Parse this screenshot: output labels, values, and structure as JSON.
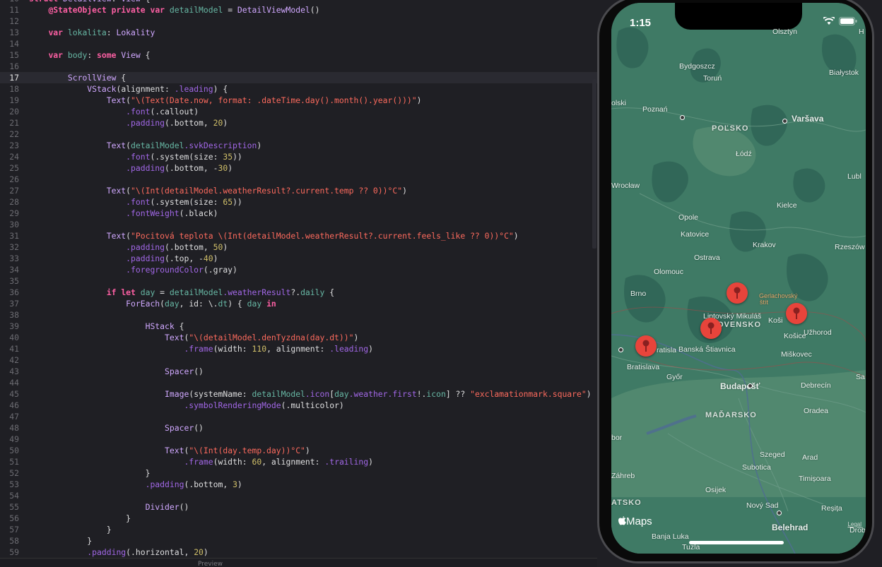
{
  "editor": {
    "lines": [
      {
        "n": "10",
        "text": "struct DetailView: View {"
      },
      {
        "n": "11",
        "text": "    @StateObject private var detailModel = DetailViewModel()"
      },
      {
        "n": "12",
        "text": ""
      },
      {
        "n": "13",
        "text": "    var lokalita: Lokality"
      },
      {
        "n": "14",
        "text": ""
      },
      {
        "n": "15",
        "text": "    var body: some View {"
      },
      {
        "n": "16",
        "text": ""
      },
      {
        "n": "17",
        "text": "        ScrollView {"
      },
      {
        "n": "18",
        "text": "            VStack(alignment: .leading) {"
      },
      {
        "n": "19",
        "text": "                Text(\"\\(Text(Date.now, format: .dateTime.day().month().year()))\")"
      },
      {
        "n": "20",
        "text": "                    .font(.callout)"
      },
      {
        "n": "21",
        "text": "                    .padding(.bottom, 20)"
      },
      {
        "n": "22",
        "text": ""
      },
      {
        "n": "23",
        "text": "                Text(detailModel.svkDescription)"
      },
      {
        "n": "24",
        "text": "                    .font(.system(size: 35))"
      },
      {
        "n": "25",
        "text": "                    .padding(.bottom, -30)"
      },
      {
        "n": "26",
        "text": ""
      },
      {
        "n": "27",
        "text": "                Text(\"\\(Int(detailModel.weatherResult?.current.temp ?? 0))°C\")"
      },
      {
        "n": "28",
        "text": "                    .font(.system(size: 65))"
      },
      {
        "n": "29",
        "text": "                    .fontWeight(.black)"
      },
      {
        "n": "30",
        "text": ""
      },
      {
        "n": "31",
        "text": "                Text(\"Pocitová teplota \\(Int(detailModel.weatherResult?.current.feels_like ?? 0))°C\")"
      },
      {
        "n": "32",
        "text": "                    .padding(.bottom, 50)"
      },
      {
        "n": "33",
        "text": "                    .padding(.top, -40)"
      },
      {
        "n": "34",
        "text": "                    .foregroundColor(.gray)"
      },
      {
        "n": "35",
        "text": ""
      },
      {
        "n": "36",
        "text": "                if let day = detailModel.weatherResult?.daily {"
      },
      {
        "n": "37",
        "text": "                    ForEach(day, id: \\.dt) { day in"
      },
      {
        "n": "38",
        "text": ""
      },
      {
        "n": "39",
        "text": "                        HStack {"
      },
      {
        "n": "40",
        "text": "                            Text(\"\\(detailModel.denTyzdna(day.dt))\")"
      },
      {
        "n": "41",
        "text": "                                .frame(width: 110, alignment: .leading)"
      },
      {
        "n": "42",
        "text": ""
      },
      {
        "n": "43",
        "text": "                            Spacer()"
      },
      {
        "n": "44",
        "text": ""
      },
      {
        "n": "45",
        "text": "                            Image(systemName: detailModel.icon[day.weather.first!.icon] ?? \"exclamationmark.square\")"
      },
      {
        "n": "46",
        "text": "                                .symbolRenderingMode(.multicolor)"
      },
      {
        "n": "47",
        "text": ""
      },
      {
        "n": "48",
        "text": "                            Spacer()"
      },
      {
        "n": "49",
        "text": ""
      },
      {
        "n": "50",
        "text": "                            Text(\"\\(Int(day.temp.day))°C\")"
      },
      {
        "n": "51",
        "text": "                                .frame(width: 60, alignment: .trailing)"
      },
      {
        "n": "52",
        "text": "                        }"
      },
      {
        "n": "53",
        "text": "                        .padding(.bottom, 3)"
      },
      {
        "n": "54",
        "text": ""
      },
      {
        "n": "55",
        "text": "                        Divider()"
      },
      {
        "n": "56",
        "text": "                    }"
      },
      {
        "n": "57",
        "text": "                }"
      },
      {
        "n": "58",
        "text": "            }"
      },
      {
        "n": "59",
        "text": "            .padding(.horizontal, 20)"
      }
    ]
  },
  "statusbar": {
    "label": "Preview"
  },
  "phone": {
    "time": "1:15",
    "maps_logo": "Maps",
    "legal": "Legal",
    "labels": {
      "olsztyn": "Olsztyn",
      "h": "H",
      "bydgoszcz": "Bydgoszcz",
      "torun": "Toruń",
      "bialystok": "Białystok",
      "olski": "olski",
      "poznan": "Poznań",
      "varsava": "Varšava",
      "polsko": "POĽSKO",
      "lodz": "Łódź",
      "lubl": "Lubl",
      "wroclaw": "Wrocław",
      "kielce": "Kielce",
      "opole": "Opole",
      "katovice": "Katovice",
      "krakov": "Krakov",
      "rzeszow": "Rzeszów",
      "ostrava": "Ostrava",
      "olomouc": "Olomouc",
      "brno": "Brno",
      "gerlach": "Gerlachovský",
      "stit": "štít",
      "liptovsky": "Liptovský Mikuláš",
      "slovensko": "OVENSKO",
      "kosice1": "Koši",
      "uzhorod": "Užhorod",
      "kosice2": "Košice",
      "ratisla": "ratisla",
      "banska": "Banská Štiavnica",
      "miskovec": "Miškovec",
      "bratislava": "Bratislava",
      "gyor": "Győr",
      "budapest": "Budapešť",
      "debrecin": "Debrecín",
      "sa": "Sa",
      "oradea": "Oradea",
      "madarsko": "MAĎARSKO",
      "bor": "bor",
      "szeged": "Szeged",
      "arad": "Arad",
      "subotica": "Subotica",
      "zahreb": "Záhreb",
      "timisoara": "Timișoara",
      "osijek": "Osijek",
      "atsko": "ATSKO",
      "novysad": "Nový Sad",
      "resita": "Reșița",
      "belehrad": "Belehrad",
      "drob": "Drob",
      "banjaluka": "Banja Luka",
      "tuzla": "Tuzla"
    }
  }
}
